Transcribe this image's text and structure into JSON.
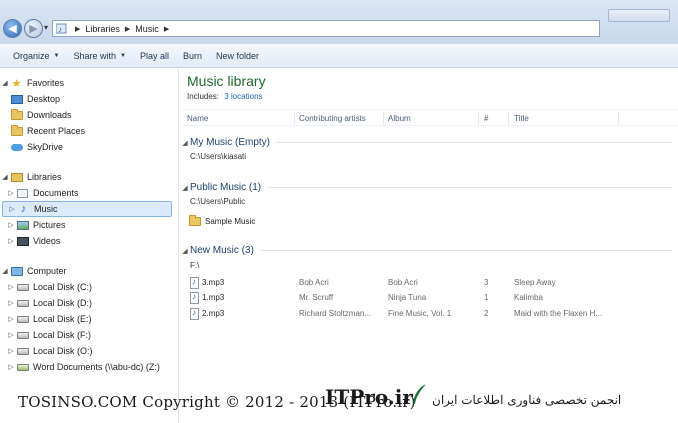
{
  "address": {
    "breadcrumb": [
      "Libraries",
      "Music"
    ]
  },
  "toolbar": {
    "organize": "Organize",
    "share_with": "Share with",
    "play_all": "Play all",
    "burn": "Burn",
    "new_folder": "New folder"
  },
  "navigation": {
    "favorites": "Favorites",
    "desktop": "Desktop",
    "downloads": "Downloads",
    "recent_places": "Recent Places",
    "skydrive": "SkyDrive",
    "libraries": "Libraries",
    "documents": "Documents",
    "music": "Music",
    "pictures": "Pictures",
    "videos": "Videos",
    "computer": "Computer",
    "drive_c": "Local Disk (C:)",
    "drive_d": "Local Disk (D:)",
    "drive_e": "Local Disk (E:)",
    "drive_f": "Local Disk (F:)",
    "drive_o": "Local Disk (O:)",
    "drive_z": "Word Documents (\\\\abu-dc) (Z:)"
  },
  "library": {
    "title": "Music library",
    "includes_label": "Includes:",
    "locations_link": "3 locations"
  },
  "columns": {
    "name": "Name",
    "artists": "Contributing artists",
    "album": "Album",
    "number": "#",
    "title": "Title"
  },
  "groups": {
    "my_music": {
      "name": "My Music (Empty)",
      "path": "C:\\Users\\kiasati"
    },
    "public_music": {
      "name": "Public Music (1)",
      "path": "C:\\Users\\Public",
      "folder": "Sample Music"
    },
    "new_music": {
      "name": "New Music (3)",
      "path": "F:\\"
    }
  },
  "files": [
    {
      "name": "3.mp3",
      "artist": "Bob Acri",
      "album": "Bob Acri",
      "number": "3",
      "title": "Sleep Away"
    },
    {
      "name": "1.mp3",
      "artist": "Mr. Scruff",
      "album": "Ninja Tuna",
      "number": "1",
      "title": "Kalimba"
    },
    {
      "name": "2.mp3",
      "artist": "Richard Stoltzman...",
      "album": "Fine Music, Vol. 1",
      "number": "2",
      "title": "Maid with the Flaxen H..."
    }
  ],
  "watermark": {
    "left_text": "TOSINSO.COM",
    "copyright": "Copyright © 2012 - 2013 (ITPro.ir)",
    "brand": "ITPro.ir",
    "arabic": "انجمن تخصصی فناوری اطلاعات ایران"
  }
}
